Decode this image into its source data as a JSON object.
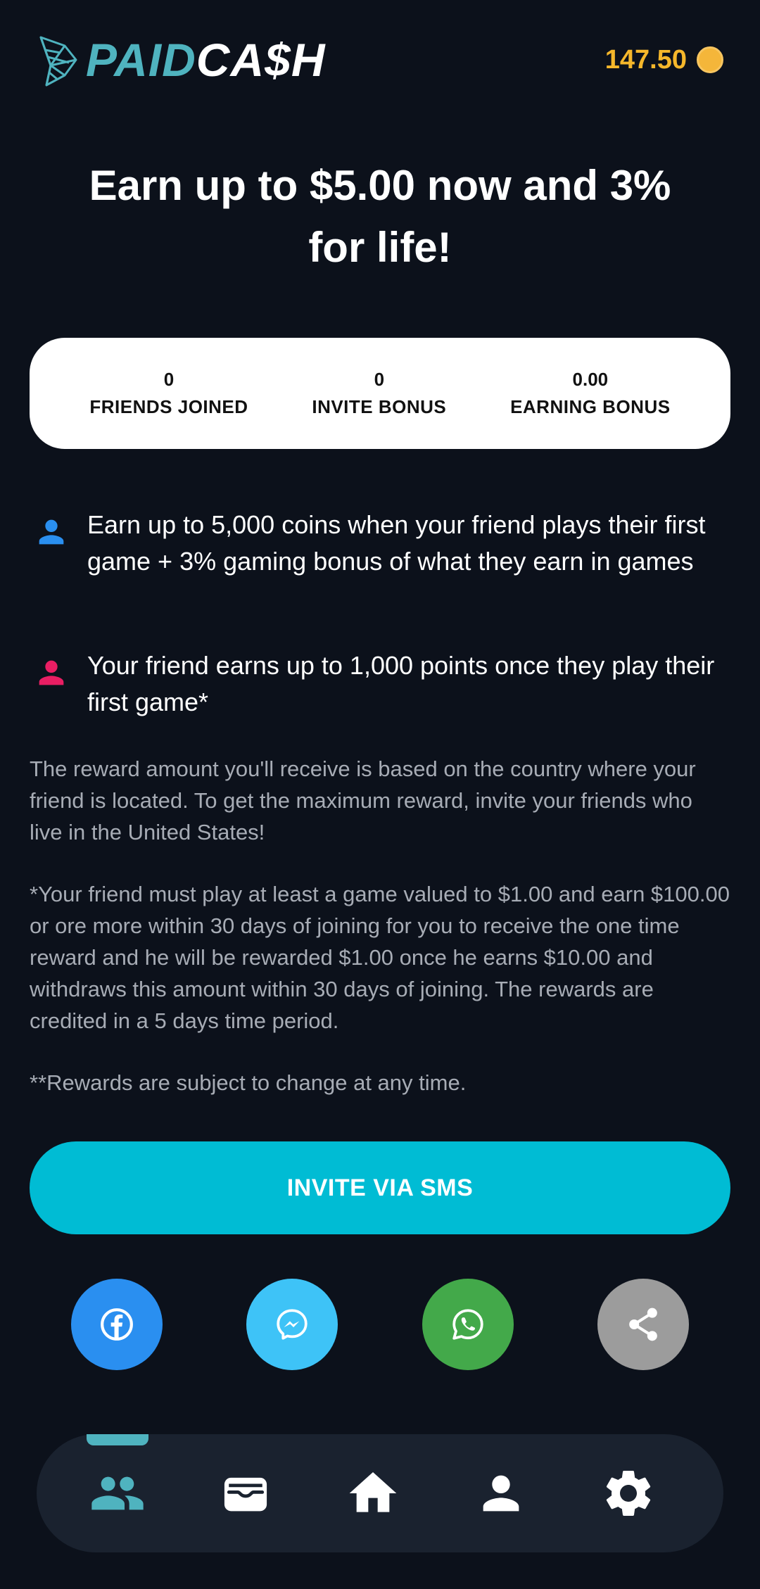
{
  "header": {
    "logo_part1": "PAID",
    "logo_part2": "CA$H",
    "balance": "147.50"
  },
  "headline": "Earn up to $5.00 now and 3% for life!",
  "stats": [
    {
      "value": "0",
      "label": "FRIENDS JOINED"
    },
    {
      "value": "0",
      "label": "INVITE BONUS"
    },
    {
      "value": "0.00",
      "label": "EARNING BONUS"
    }
  ],
  "benefits": [
    {
      "text": "Earn up to 5,000 coins when your friend plays their first game + 3% gaming bonus of what they earn in games",
      "icon": "person-icon",
      "color": "#2a8ff0"
    },
    {
      "text": "Your friend earns up to 1,000 points once they play their first game*",
      "icon": "person-icon",
      "color": "#e91e63"
    }
  ],
  "notes": [
    "The reward amount you'll receive is based on the country where your friend is located. To get the maximum reward, invite your friends who live in the United States!",
    "*Your friend must play at least a game valued to $1.00 and earn $100.00 or ore more within 30 days of joining for you to receive the one time reward and he will be rewarded $1.00 once he earns $10.00 and withdraws this amount within 30 days of joining. The rewards are credited in a 5 days time period.",
    "**Rewards are subject to change at any time."
  ],
  "sms_button_label": "INVITE VIA SMS",
  "share_buttons": [
    {
      "icon": "facebook-icon",
      "color": "#2a8ff0"
    },
    {
      "icon": "messenger-icon",
      "color": "#3ec3f7"
    },
    {
      "icon": "whatsapp-icon",
      "color": "#43a94a"
    },
    {
      "icon": "share-icon",
      "color": "#9c9c9c"
    }
  ],
  "nav": {
    "active": "friends",
    "items": [
      "friends-icon",
      "wallet-icon",
      "home-icon",
      "profile-icon",
      "settings-icon"
    ]
  },
  "colors": {
    "background": "#0c111b",
    "accent": "#4fb3bf",
    "balance": "#f5b72b",
    "sms_button": "#00bcd4",
    "nav_bg": "#1a222f"
  }
}
